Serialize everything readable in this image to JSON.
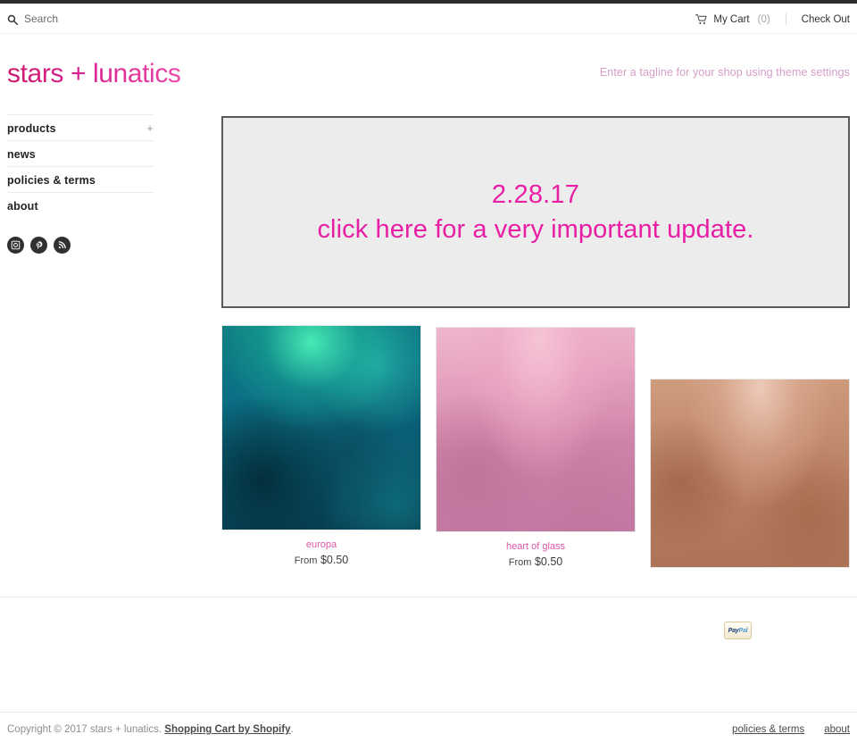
{
  "topbar": {
    "search_placeholder": "Search",
    "search_value": "",
    "search_icon": "search-icon",
    "cart_icon": "shopping-cart-icon",
    "cart_label": "My Cart",
    "cart_count": "(0)",
    "checkout_label": "Check Out"
  },
  "header": {
    "logo": "stars + lunatics",
    "tagline": "Enter a tagline for your shop using theme settings",
    "logo_color": "#d61f8e",
    "tagline_color": "#d49ec5"
  },
  "sidebar": {
    "items": [
      {
        "label": "products",
        "expander": "+"
      },
      {
        "label": "news",
        "expander": ""
      },
      {
        "label": "policies & terms",
        "expander": ""
      },
      {
        "label": "about",
        "expander": ""
      }
    ],
    "social": [
      {
        "name": "instagram-icon",
        "title": "Instagram"
      },
      {
        "name": "pinterest-icon",
        "title": "Pinterest"
      },
      {
        "name": "rss-icon",
        "title": "RSS"
      }
    ]
  },
  "banner": {
    "line1": "2.28.17",
    "line2": "click here for a very important update.",
    "text_color": "#e81fa5",
    "background_color": "#ececec",
    "border_color": "#5a5a5a"
  },
  "products": [
    {
      "title": "europa",
      "price_prefix": "From",
      "price": "$0.50",
      "swatch": "teal-green-glitter-powder"
    },
    {
      "title": "heart of glass",
      "price_prefix": "From",
      "price": "$0.50",
      "swatch": "pink-shimmer-powder"
    },
    {
      "title": "",
      "price_prefix": "",
      "price": "",
      "swatch": "bronze-copper-shimmer-powder"
    }
  ],
  "footer": {
    "payment_badge": "PayPal",
    "payment_badge_part1": "Pay",
    "payment_badge_part2": "Pal",
    "copyright_text": "Copyright © 2017 stars + lunatics.",
    "copyright_link": "Shopping Cart by Shopify",
    "copyright_suffix": ".",
    "links": [
      {
        "label": "policies & terms"
      },
      {
        "label": "about"
      }
    ]
  }
}
